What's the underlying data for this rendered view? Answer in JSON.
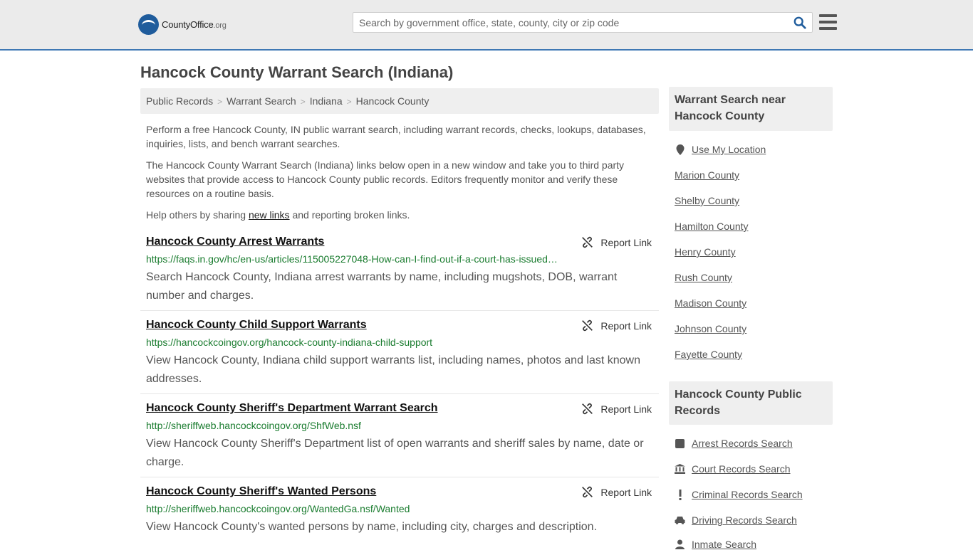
{
  "header": {
    "logo_text_main": "CountyOffice",
    "logo_text_org": ".org",
    "search_placeholder": "Search by government office, state, county, city or zip code"
  },
  "page_title": "Hancock County Warrant Search (Indiana)",
  "breadcrumb": [
    "Public Records",
    "Warrant Search",
    "Indiana",
    "Hancock County"
  ],
  "intro": {
    "p1": "Perform a free Hancock County, IN public warrant search, including warrant records, checks, lookups, databases, inquiries, lists, and bench warrant searches.",
    "p2": "The Hancock County Warrant Search (Indiana) links below open in a new window and take you to third party websites that provide access to Hancock County public records. Editors frequently monitor and verify these resources on a routine basis.",
    "p3_before": "Help others by sharing ",
    "p3_link": "new links",
    "p3_after": " and reporting broken links."
  },
  "report_label": "Report Link",
  "results": [
    {
      "title": "Hancock County Arrest Warrants",
      "url": "https://faqs.in.gov/hc/en-us/articles/115005227048-How-can-I-find-out-if-a-court-has-issued…",
      "desc": "Search Hancock County, Indiana arrest warrants by name, including mugshots, DOB, warrant number and charges."
    },
    {
      "title": "Hancock County Child Support Warrants",
      "url": "https://hancockcoingov.org/hancock-county-indiana-child-support",
      "desc": "View Hancock County, Indiana child support warrants list, including names, photos and last known addresses."
    },
    {
      "title": "Hancock County Sheriff's Department Warrant Search",
      "url": "http://sheriffweb.hancockcoingov.org/ShfWeb.nsf",
      "desc": "View Hancock County Sheriff's Department list of open warrants and sheriff sales by name, date or charge."
    },
    {
      "title": "Hancock County Sheriff's Wanted Persons",
      "url": "http://sheriffweb.hancockcoingov.org/WantedGa.nsf/Wanted",
      "desc": "View Hancock County's wanted persons by name, including city, charges and description."
    }
  ],
  "sidebar": {
    "nearby_title": "Warrant Search near Hancock County",
    "use_location": "Use My Location",
    "nearby": [
      "Marion County",
      "Shelby County",
      "Hamilton County",
      "Henry County",
      "Rush County",
      "Madison County",
      "Johnson County",
      "Fayette County"
    ],
    "records_title": "Hancock County Public Records",
    "records": [
      {
        "label": "Arrest Records Search",
        "icon": "square-icon"
      },
      {
        "label": "Court Records Search",
        "icon": "courthouse-icon"
      },
      {
        "label": "Criminal Records Search",
        "icon": "exclamation-icon"
      },
      {
        "label": "Driving Records Search",
        "icon": "car-icon"
      },
      {
        "label": "Inmate Search",
        "icon": "inmate-icon"
      }
    ]
  }
}
